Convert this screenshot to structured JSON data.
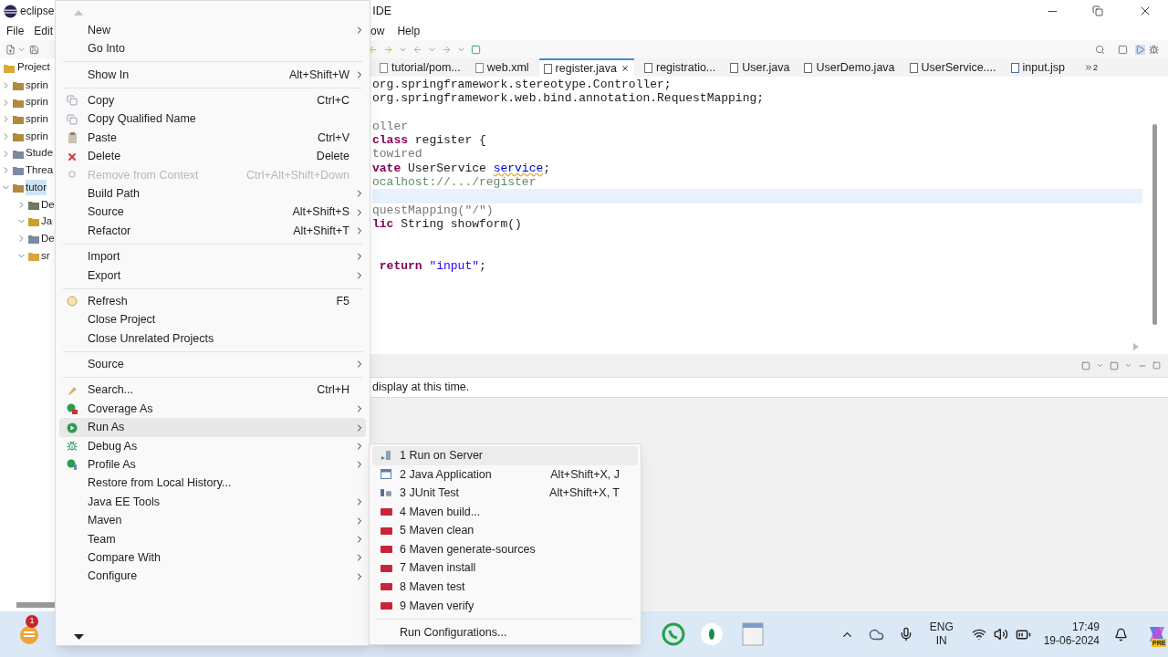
{
  "window": {
    "title_left": "eclipse",
    "title_right": "IDE"
  },
  "menu_bar": [
    "File",
    "Edit",
    "ow",
    "Help"
  ],
  "explorer": {
    "title": "Project",
    "tree": [
      {
        "label": "sprin",
        "expanded": false,
        "selected": false,
        "kind": "project"
      },
      {
        "label": "sprin",
        "expanded": false,
        "selected": false,
        "kind": "project"
      },
      {
        "label": "sprin",
        "expanded": false,
        "selected": false,
        "kind": "project"
      },
      {
        "label": "sprin",
        "expanded": false,
        "selected": false,
        "kind": "project"
      },
      {
        "label": "Stude",
        "expanded": false,
        "selected": false,
        "kind": "folder"
      },
      {
        "label": "Threa",
        "expanded": false,
        "selected": false,
        "kind": "folder"
      },
      {
        "label": "tutor",
        "expanded": true,
        "selected": true,
        "kind": "project",
        "children": [
          {
            "label": "De",
            "expanded": false,
            "selected": false,
            "kind": "descriptor"
          },
          {
            "label": "Ja",
            "expanded": true,
            "selected": false,
            "kind": "resources"
          },
          {
            "label": "De",
            "expanded": false,
            "selected": false,
            "kind": "folder"
          },
          {
            "label": "sr",
            "expanded": true,
            "selected": false,
            "kind": "open-folder"
          }
        ]
      }
    ]
  },
  "editor_tabs": [
    {
      "label": "tutorial/pom...",
      "selected": false,
      "kind": "xml"
    },
    {
      "label": "web.xml",
      "selected": false,
      "kind": "xml"
    },
    {
      "label": "register.java",
      "selected": true,
      "kind": "java"
    },
    {
      "label": "registratio...",
      "selected": false,
      "kind": "java"
    },
    {
      "label": "User.java",
      "selected": false,
      "kind": "java"
    },
    {
      "label": "UserDemo.java",
      "selected": false,
      "kind": "java"
    },
    {
      "label": "UserService....",
      "selected": false,
      "kind": "java"
    },
    {
      "label": "input.jsp",
      "selected": false,
      "kind": "jsp"
    }
  ],
  "hidden_tabs_count": "2",
  "code_lines": [
    {
      "current": false,
      "tokens": [
        {
          "kind": "plain",
          "text": "org.springframework.stereotype.Controller;"
        }
      ]
    },
    {
      "current": false,
      "tokens": [
        {
          "kind": "plain",
          "text": "org.springframework.web.bind.annotation.RequestMapping;"
        }
      ]
    },
    {
      "current": false
    },
    {
      "current": false,
      "tokens": [
        {
          "kind": "annotation",
          "text": "oller"
        }
      ]
    },
    {
      "current": false,
      "tokens": [
        {
          "kind": "keyword",
          "text": "class"
        },
        {
          "kind": "plain",
          "text": " register {"
        }
      ]
    },
    {
      "current": false,
      "tokens": [
        {
          "kind": "annotation",
          "text": "towired"
        }
      ]
    },
    {
      "current": false,
      "tokens": [
        {
          "kind": "keyword",
          "text": "vate"
        },
        {
          "kind": "plain",
          "text": " UserService "
        },
        {
          "kind": "field",
          "text": "service"
        },
        {
          "kind": "plain",
          "text": ";"
        }
      ]
    },
    {
      "current": false,
      "tokens": [
        {
          "kind": "comment",
          "text": "ocalhost://.../register"
        }
      ]
    },
    {
      "current": true
    },
    {
      "current": false,
      "tokens": [
        {
          "kind": "annotation",
          "text": "questMapping(\"/\")"
        }
      ]
    },
    {
      "current": false,
      "tokens": [
        {
          "kind": "keyword",
          "text": "lic"
        },
        {
          "kind": "plain",
          "text": " String showform()"
        }
      ]
    },
    {
      "current": false
    },
    {
      "current": false
    },
    {
      "current": false,
      "tokens": [
        {
          "kind": "keyword",
          "text": " return"
        },
        {
          "kind": "string",
          "text": " \"input\""
        },
        {
          "kind": "plain",
          "text": ";"
        }
      ]
    }
  ],
  "panel": {
    "message": "display at this time."
  },
  "context_menu": {
    "groups": [
      [
        {
          "label": "New",
          "submenu": true,
          "kind": "plain",
          "disabled": false,
          "selected": false
        },
        {
          "label": "Go Into",
          "submenu": false,
          "kind": "plain",
          "disabled": false,
          "selected": false
        }
      ],
      [
        {
          "label": "Show In",
          "shortcut": "Alt+Shift+W",
          "submenu": true,
          "kind": "plain",
          "disabled": false,
          "selected": false
        }
      ],
      [
        {
          "label": "Copy",
          "shortcut": "Ctrl+C",
          "submenu": false,
          "kind": "copy",
          "disabled": false,
          "selected": false
        },
        {
          "label": "Copy Qualified Name",
          "submenu": false,
          "kind": "copy-name",
          "disabled": false,
          "selected": false
        },
        {
          "label": "Paste",
          "shortcut": "Ctrl+V",
          "submenu": false,
          "kind": "paste",
          "disabled": false,
          "selected": false
        },
        {
          "label": "Delete",
          "shortcut": "Delete",
          "submenu": false,
          "kind": "delete",
          "disabled": false,
          "selected": false
        },
        {
          "label": "Remove from Context",
          "shortcut": "Ctrl+Alt+Shift+Down",
          "submenu": false,
          "kind": "remove",
          "disabled": true,
          "selected": false
        },
        {
          "label": "Build Path",
          "submenu": true,
          "kind": "plain",
          "disabled": false,
          "selected": false
        },
        {
          "label": "Source",
          "shortcut": "Alt+Shift+S",
          "submenu": true,
          "kind": "plain",
          "disabled": false,
          "selected": false
        },
        {
          "label": "Refactor",
          "shortcut": "Alt+Shift+T",
          "submenu": true,
          "kind": "plain",
          "disabled": false,
          "selected": false
        }
      ],
      [
        {
          "label": "Import",
          "submenu": true,
          "kind": "plain",
          "disabled": false,
          "selected": false
        },
        {
          "label": "Export",
          "submenu": true,
          "kind": "plain",
          "disabled": false,
          "selected": false
        }
      ],
      [
        {
          "label": "Refresh",
          "shortcut": "F5",
          "submenu": false,
          "kind": "refresh",
          "disabled": false,
          "selected": false
        },
        {
          "label": "Close Project",
          "submenu": false,
          "kind": "plain",
          "disabled": false,
          "selected": false
        },
        {
          "label": "Close Unrelated Projects",
          "submenu": false,
          "kind": "plain",
          "disabled": false,
          "selected": false
        }
      ],
      [
        {
          "label": "Source",
          "submenu": true,
          "kind": "plain",
          "disabled": false,
          "selected": false
        }
      ],
      [
        {
          "label": "Search...",
          "shortcut": "Ctrl+H",
          "submenu": false,
          "kind": "search",
          "disabled": false,
          "selected": false
        },
        {
          "label": "Coverage As",
          "submenu": true,
          "kind": "coverage",
          "disabled": false,
          "selected": false
        },
        {
          "label": "Run As",
          "submenu": true,
          "kind": "run",
          "disabled": false,
          "selected": true
        },
        {
          "label": "Debug As",
          "submenu": true,
          "kind": "debug",
          "disabled": false,
          "selected": false
        },
        {
          "label": "Profile As",
          "submenu": true,
          "kind": "profile",
          "disabled": false,
          "selected": false
        },
        {
          "label": "Restore from Local History...",
          "submenu": false,
          "kind": "plain",
          "disabled": false,
          "selected": false
        },
        {
          "label": "Java EE Tools",
          "submenu": true,
          "kind": "plain",
          "disabled": false,
          "selected": false
        },
        {
          "label": "Maven",
          "submenu": true,
          "kind": "plain",
          "disabled": false,
          "selected": false
        },
        {
          "label": "Team",
          "submenu": true,
          "kind": "plain",
          "disabled": false,
          "selected": false
        },
        {
          "label": "Compare With",
          "submenu": true,
          "kind": "plain",
          "disabled": false,
          "selected": false
        },
        {
          "label": "Configure",
          "submenu": true,
          "kind": "plain",
          "disabled": false,
          "selected": false
        }
      ]
    ]
  },
  "submenu": {
    "groups": [
      [
        {
          "label": "1 Run on Server",
          "kind": "server",
          "selected": true
        },
        {
          "label": "2 Java Application",
          "shortcut": "Alt+Shift+X, J",
          "kind": "java-app",
          "selected": false
        },
        {
          "label": "3 JUnit Test",
          "shortcut": "Alt+Shift+X, T",
          "kind": "junit",
          "selected": false
        },
        {
          "label": "4 Maven build...",
          "kind": "maven",
          "selected": false
        },
        {
          "label": "5 Maven clean",
          "kind": "maven",
          "selected": false
        },
        {
          "label": "6 Maven generate-sources",
          "kind": "maven",
          "selected": false
        },
        {
          "label": "7 Maven install",
          "kind": "maven",
          "selected": false
        },
        {
          "label": "8 Maven test",
          "kind": "maven",
          "selected": false
        },
        {
          "label": "9 Maven verify",
          "kind": "maven",
          "selected": false
        }
      ],
      [
        {
          "label": "Run Configurations...",
          "kind": "plain",
          "selected": false
        }
      ]
    ]
  },
  "taskbar": {
    "notification_badge": "1",
    "language": "ENG",
    "region": "IN",
    "time": "17:49",
    "date": "19-06-2024",
    "copilot_badge": "PRE"
  }
}
